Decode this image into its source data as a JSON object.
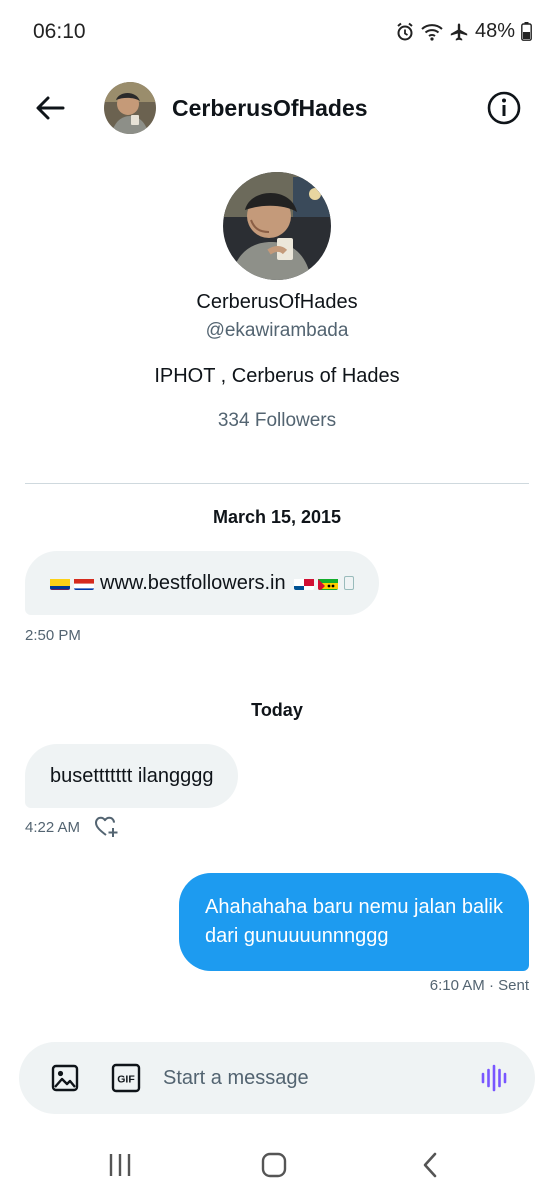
{
  "status_bar": {
    "time": "06:10",
    "battery": "48%",
    "icons": [
      "alarm-icon",
      "wifi-icon",
      "airplane-icon",
      "battery-icon"
    ]
  },
  "header": {
    "name": "CerberusOfHades",
    "back_icon": "arrow-left-icon",
    "info_icon": "info-icon"
  },
  "profile": {
    "name": "CerberusOfHades",
    "handle": "@ekawirambada",
    "bio": "IPHOT , Cerberus of Hades",
    "followers": "334 Followers"
  },
  "conversation": {
    "date_1": "March 15, 2015",
    "msg_1": {
      "text": "www.bestfollowers.in",
      "time": "2:50 PM"
    },
    "date_2": "Today",
    "msg_2": {
      "text": "busettttttt ilangggg",
      "time": "4:22 AM"
    },
    "msg_3": {
      "line1": "Ahahahaha baru nemu jalan balik",
      "line2": "dari gunuuuunnnggg",
      "time": "6:10 AM · Sent"
    }
  },
  "composer": {
    "placeholder": "Start a message",
    "gif_label": "GIF"
  },
  "colors": {
    "accent": "#1d9bf0",
    "bubble_in": "#eff3f4",
    "secondary_text": "#536471",
    "voice_icon": "#7856ff"
  }
}
